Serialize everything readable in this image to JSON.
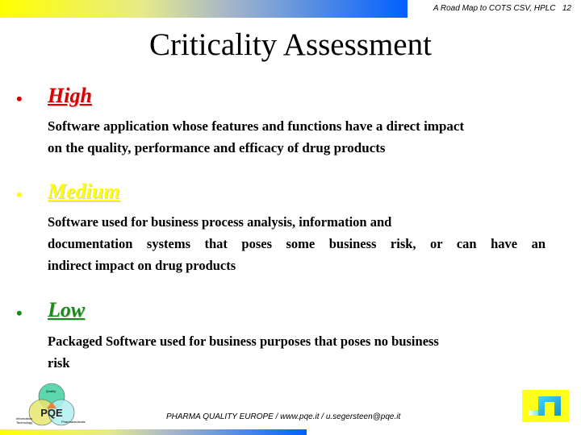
{
  "header": {
    "running_title": "A Road Map to COTS CSV, HPLC",
    "page_number": "12"
  },
  "title": "Criticality Assessment",
  "items": [
    {
      "bullet": "•",
      "heading": "High",
      "color": "#dd0000",
      "description_lines": [
        "Software application whose features and functions have a direct impact",
        "on the quality, performance and efficacy of drug products"
      ]
    },
    {
      "bullet": "•",
      "heading": "Medium",
      "color": "#ffff00",
      "description_lines": [
        "Software used for business process analysis, information and",
        "documentation systems that poses some business risk, or can have an",
        "indirect impact on drug products"
      ]
    },
    {
      "bullet": "•",
      "heading": "Low",
      "color": "#1a8a1a",
      "description_lines": [
        "Packaged Software used for business purposes that poses no business",
        "risk"
      ]
    }
  ],
  "footer": {
    "text": "PHARMA QUALITY EUROPE / www.pqe.it / u.segersteen@pqe.it",
    "logo": {
      "name": "PQE",
      "circle_labels": [
        "Quality",
        "Information Technology",
        "Pharmaceuticals"
      ]
    }
  }
}
